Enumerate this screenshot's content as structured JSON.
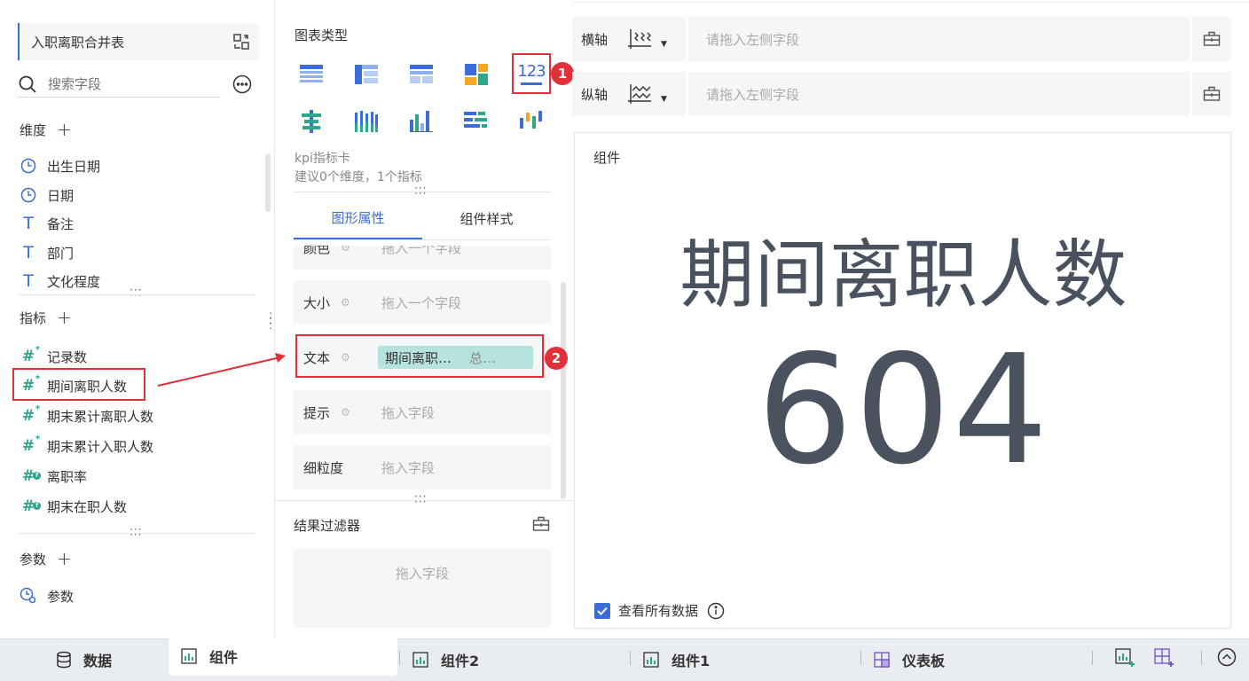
{
  "dataset": {
    "name": "入职离职合并表"
  },
  "search": {
    "placeholder": "搜索字段"
  },
  "dimensions": {
    "title": "维度",
    "items": [
      "出生日期",
      "日期",
      "备注",
      "部门",
      "文化程度"
    ]
  },
  "measures": {
    "title": "指标",
    "items": [
      "记录数",
      "期间离职人数",
      "期末累计离职人数",
      "期末累计入职人数",
      "离职率",
      "期末在职人数"
    ]
  },
  "params": {
    "title": "参数",
    "items": [
      "参数"
    ]
  },
  "chart_type": {
    "title": "图表类型",
    "selected_name": "kpi指标卡",
    "hint": "建议0个维度，1个指标",
    "kpi_glyph": "123"
  },
  "tabs": {
    "graph": "图形属性",
    "style": "组件样式"
  },
  "props": {
    "partial_label": "颜色",
    "partial_ph": "拖入一个字段",
    "size": {
      "label": "大小",
      "ph": "拖入一个字段"
    },
    "text": {
      "label": "文本",
      "pill_field": "期间离职…",
      "pill_agg": "总…"
    },
    "tip": {
      "label": "提示",
      "ph": "拖入字段"
    },
    "gran": {
      "label": "细粒度",
      "ph": "拖入字段"
    }
  },
  "filter": {
    "title": "结果过滤器",
    "ph": "拖入字段"
  },
  "axes": {
    "x_label": "横轴",
    "y_label": "纵轴",
    "ph": "请拖入左侧字段"
  },
  "canvas": {
    "title": "组件",
    "kpi_title": "期间离职人数",
    "kpi_value": "604",
    "view_all": "查看所有数据"
  },
  "bottom": {
    "data": "数据",
    "tab1": "组件",
    "tab2": "组件2",
    "tab3": "组件1",
    "tab4": "仪表板"
  },
  "badges": {
    "b1": "1",
    "b2": "2"
  },
  "colors": {
    "accent": "#3c6cd8",
    "teal": "#2fa58c",
    "red": "#e0303a",
    "pill": "#b6e3dd"
  }
}
